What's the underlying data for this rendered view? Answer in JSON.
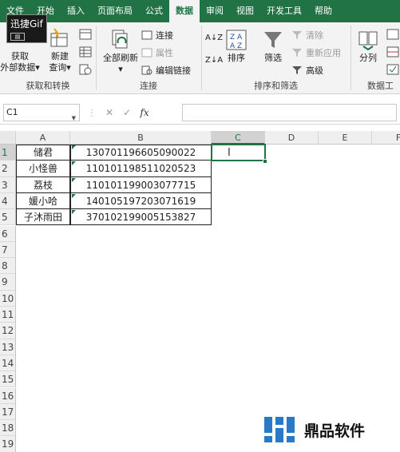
{
  "watermark_top": {
    "text": "迅捷Gif"
  },
  "tabs": [
    "文件",
    "开始",
    "插入",
    "页面布局",
    "公式",
    "数据",
    "审阅",
    "视图",
    "开发工具",
    "帮助"
  ],
  "active_tab": "数据",
  "ribbon": {
    "get_data": {
      "label1": "获取",
      "label2": "外部数据",
      "arrow": "▾"
    },
    "new_query": {
      "label1": "新建",
      "label2": "查询",
      "arrow": "▾"
    },
    "group1": "获取和转换",
    "refresh_all": {
      "label": "全部刷新",
      "arrow": "▾"
    },
    "connections": "连接",
    "properties": "属性",
    "edit_links": "编辑链接",
    "group2": "连接",
    "sort_asc": "A↓Z",
    "sort_desc": "Z↓A",
    "sort": "排序",
    "filter": "筛选",
    "clear": "清除",
    "reapply": "重新应用",
    "advanced": "高级",
    "group3": "排序和筛选",
    "split": "分列",
    "group4": "数据工"
  },
  "formula_bar": {
    "name_box": "C1",
    "cancel": "✕",
    "enter": "✓",
    "fx": "fx",
    "value": ""
  },
  "columns": [
    "A",
    "B",
    "C",
    "D",
    "E",
    "F"
  ],
  "rows": [
    "1",
    "2",
    "3",
    "4",
    "5",
    "6",
    "7",
    "8",
    "9",
    "10",
    "11",
    "12",
    "13",
    "14",
    "15",
    "16",
    "17",
    "18",
    "19"
  ],
  "data": [
    {
      "a": "储君",
      "b": "130701196605090022"
    },
    {
      "a": "小怪兽",
      "b": "110101198511020523"
    },
    {
      "a": "荔枝",
      "b": "110101199003077715"
    },
    {
      "a": "媛小哈",
      "b": "140105197203071619"
    },
    {
      "a": "子沐雨田",
      "b": "370102199005153827"
    }
  ],
  "selected_cell": "C1",
  "watermark_bottom": {
    "text": "鼎品软件"
  },
  "colors": {
    "accent": "#217346",
    "tab_bar": "#217346"
  }
}
